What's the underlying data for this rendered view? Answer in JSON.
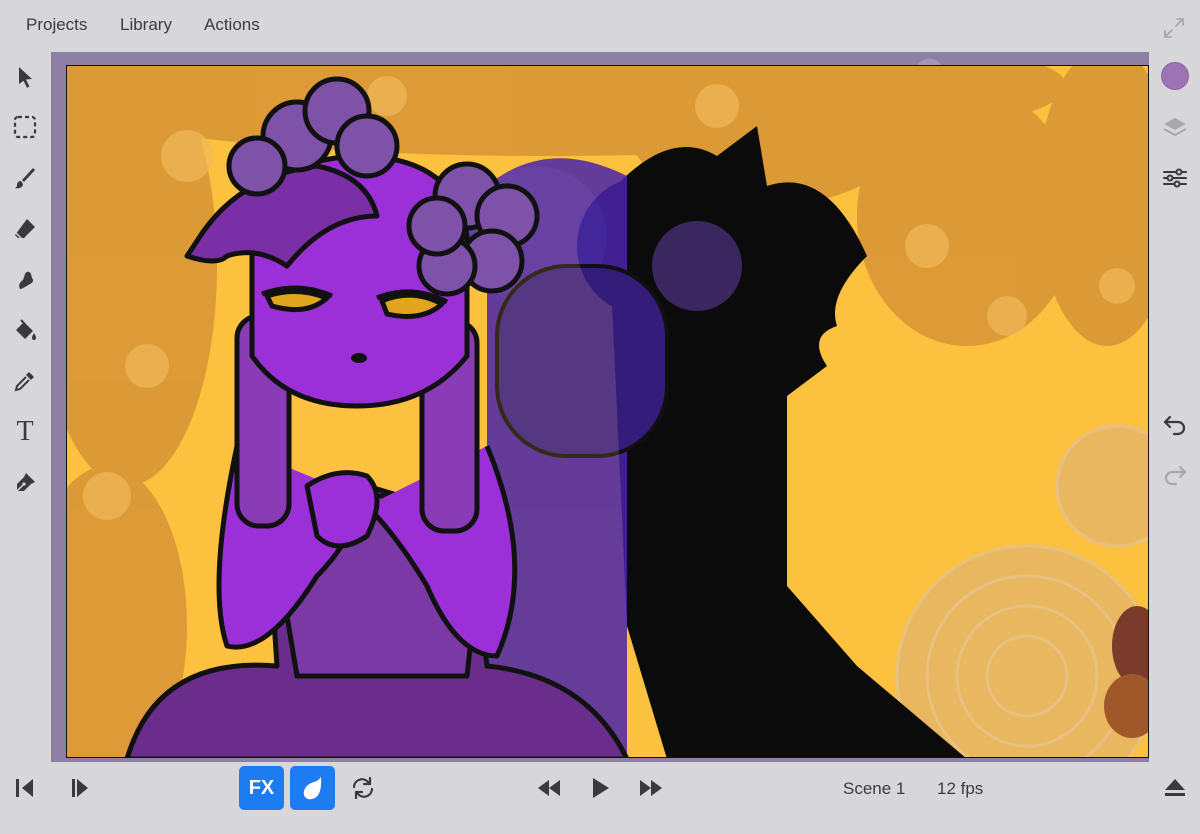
{
  "menu": {
    "projects": "Projects",
    "library": "Library",
    "actions": "Actions"
  },
  "tools": [
    "select-arrow",
    "marquee-select",
    "brush",
    "eraser",
    "smudge",
    "fill-bucket",
    "eyedropper",
    "text",
    "pen"
  ],
  "tool_glyphs": {
    "text": "T"
  },
  "right_tools": [
    "color-swatch",
    "layers",
    "adjustments",
    "undo",
    "redo"
  ],
  "current_color": "#9c74b5",
  "bottom": {
    "fx_label": "FX",
    "scene_label": "Scene 1",
    "fps_label": "12 fps"
  },
  "colors": {
    "chrome": "#d7d7d9",
    "accent": "#1e7cf2",
    "canvas_bg": "#fcc13e",
    "character_purple": "#9b30d9",
    "character_dark_purple": "#6b2d8c"
  }
}
